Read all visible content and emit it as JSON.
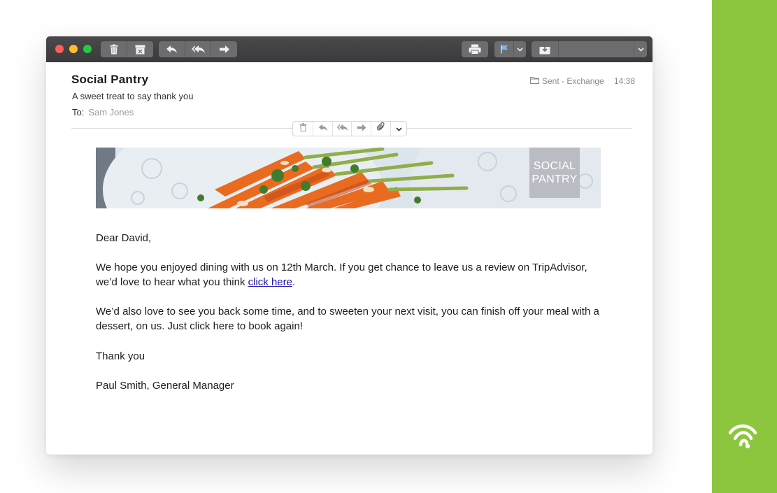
{
  "window": {
    "toolbar": {
      "traffic_lights": [
        "close",
        "minimize",
        "zoom"
      ],
      "traffic_colors": [
        "#ff5f57",
        "#febc2e",
        "#28c840"
      ],
      "left_groups": [
        [
          "trash-icon",
          "archive-icon"
        ],
        [
          "reply-icon",
          "reply-all-icon",
          "forward-icon"
        ]
      ],
      "right_controls": [
        "print-icon",
        "flag-icon",
        "move-to-icon"
      ]
    }
  },
  "message": {
    "sender": "Social Pantry",
    "subject": "A sweet treat to say thank you",
    "to_label": "To:",
    "to_value": "Sam Jones",
    "folder": "Sent - Exchange",
    "time": "14:38",
    "inline_toolbar": [
      "trash-icon",
      "reply-icon",
      "reply-all-icon",
      "forward-icon",
      "attachment-icon",
      "chevron-down-icon"
    ]
  },
  "banner": {
    "badge_line1": "SOCIAL",
    "badge_line2": "PANTRY"
  },
  "body": {
    "greeting": "Dear David,",
    "para1_before_link": "We hope you enjoyed dining with us on 12th March. If you get chance to leave us a review on TripAdvisor, we’d love to hear what you think ",
    "para1_link": "click here",
    "para1_after_link": ".",
    "para2": "We’d also love to see you back some time, and to sweeten your next visit, you can finish off your meal with a dessert, on us. Just click here to book again!",
    "closing": "Thank you",
    "signature": "Paul Smith, General Manager"
  },
  "colors": {
    "accent_green": "#8cc63f",
    "link_blue": "#1a0dab",
    "titlebar": "#3a3a3c"
  },
  "brand": {
    "icon": "wifi-icon"
  }
}
